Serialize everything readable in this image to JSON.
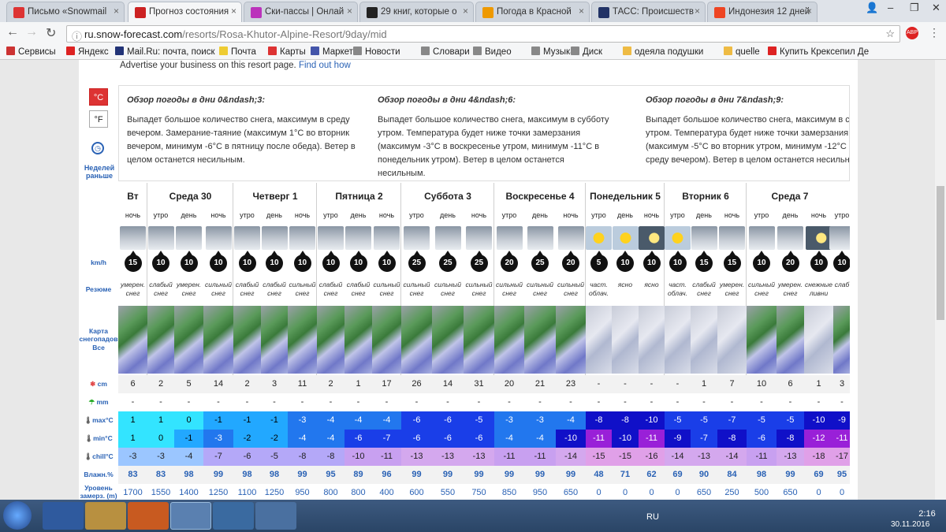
{
  "browser": {
    "tabs": [
      {
        "label": "Письмо «Snowmail",
        "color": "#d33"
      },
      {
        "label": "Прогноз состояния",
        "color": "#c22",
        "active": true
      },
      {
        "label": "Ски-пассы | Онлай",
        "color": "#b3b"
      },
      {
        "label": "29 книг, которые о",
        "color": "#222"
      },
      {
        "label": "Погода в Красной",
        "color": "#e90"
      },
      {
        "label": "ТАСС: Происшеств",
        "color": "#236"
      },
      {
        "label": "Индонезия 12 дней",
        "color": "#e42"
      }
    ],
    "url_host": "ru.snow-forecast.com",
    "url_path": "/resorts/Rosa-Khutor-Alpine-Resort/9day/mid",
    "bookmarks": [
      "Сервисы",
      "Яндекс",
      "Mail.Ru: почта, поиск",
      "Почта",
      "Карты",
      "Маркет",
      "Новости",
      "Словари",
      "Видео",
      "Музыка",
      "Диск",
      "одеяла подушки",
      "quelle",
      "Купить Крексепил Де"
    ]
  },
  "page": {
    "advertise": "Advertise your business on this resort page.",
    "advertise_link": "Find out how",
    "unit_c": "°C",
    "unit_f": "°F",
    "prev_weeks": "Неделей раньше",
    "summaries": [
      {
        "title": "Обзор погоды в дни 0&ndash;3:",
        "text": "Выпадет большое количество снега, максимум в среду вечером. Замерание-таяние (максимум 1°C во вторник вечером, минимум -6°C в пятницу после обеда). Ветер в целом останется несильным."
      },
      {
        "title": "Обзор погоды в дни 4&ndash;6:",
        "text": "Выпадет большое количество снега, максимум в субботу утром. Температура будет ниже точки замерзания (максимум -3°C в воскресенье утром, минимум -11°C в понедельник утром). Ветер в целом останется несильным."
      },
      {
        "title": "Обзор погоды в дни 7&ndash;9:",
        "text": "Выпадет большое количество снега, максимум в с утром. Температура будет ниже точки замерзания (максимум -5°C во вторник утром, минимум -12°C среду вечером). Ветер в целом останется несильн"
      }
    ],
    "labels": {
      "kmh": "km/h",
      "summary": "Резюме",
      "map": "Карта снегопадов",
      "map_all": "Все",
      "snow": "cm",
      "rain": "mm",
      "max": "max°C",
      "min": "min°C",
      "chill": "chill°C",
      "hum": "Влажн.%",
      "freeze": "Уровень замерз. (m)"
    },
    "days": [
      "Вт",
      "Среда 30",
      "Четверг 1",
      "Пятница 2",
      "Суббота 3",
      "Воскресенье 4",
      "Понедельник 5",
      "Вторник 6",
      "Среда 7"
    ],
    "periods": [
      "ночь",
      "утро",
      "день",
      "ночь",
      "утро",
      "день",
      "ночь",
      "утро",
      "день",
      "ночь",
      "утро",
      "день",
      "ночь",
      "утро",
      "день",
      "ночь",
      "утро",
      "день",
      "ночь",
      "утро",
      "день",
      "ночь",
      "утро",
      "день",
      "ночь",
      "утро"
    ],
    "wind": [
      "15",
      "10",
      "10",
      "10",
      "10",
      "10",
      "10",
      "10",
      "10",
      "10",
      "25",
      "25",
      "25",
      "20",
      "25",
      "20",
      "5",
      "10",
      "10",
      "10",
      "15",
      "15",
      "10",
      "20",
      "10",
      "10"
    ],
    "summ": [
      "умерен. снег",
      "слабый снег",
      "умерен. снег",
      "сильный снег",
      "слабый снег",
      "слабый снег",
      "сильный снег",
      "слабый снег",
      "слабый снег",
      "сильный снег",
      "сильный снег",
      "сильный снег",
      "сильный снег",
      "сильный снег",
      "сильный снег",
      "сильный снег",
      "част. облач.",
      "ясно",
      "ясно",
      "част. облач.",
      "слабый снег",
      "умерен. снег",
      "сильный снег",
      "умерен. снег",
      "снежные ливни",
      "слаб"
    ],
    "snow": [
      "6",
      "2",
      "5",
      "14",
      "2",
      "3",
      "11",
      "2",
      "1",
      "17",
      "26",
      "14",
      "31",
      "20",
      "21",
      "23",
      "-",
      "-",
      "-",
      "-",
      "1",
      "7",
      "10",
      "6",
      "1",
      "3"
    ],
    "rain": [
      "-",
      "-",
      "-",
      "-",
      "-",
      "-",
      "-",
      "-",
      "-",
      "-",
      "-",
      "-",
      "-",
      "-",
      "-",
      "-",
      "-",
      "-",
      "-",
      "-",
      "-",
      "-",
      "-",
      "-",
      "-",
      "-"
    ],
    "max": [
      "1",
      "1",
      "0",
      "-1",
      "-1",
      "-1",
      "-3",
      "-4",
      "-4",
      "-4",
      "-6",
      "-6",
      "-5",
      "-3",
      "-3",
      "-4",
      "-8",
      "-8",
      "-10",
      "-5",
      "-5",
      "-7",
      "-5",
      "-5",
      "-10",
      "-9"
    ],
    "min": [
      "1",
      "0",
      "-1",
      "-3",
      "-2",
      "-2",
      "-4",
      "-4",
      "-6",
      "-7",
      "-6",
      "-6",
      "-6",
      "-4",
      "-4",
      "-10",
      "-11",
      "-10",
      "-11",
      "-9",
      "-7",
      "-8",
      "-6",
      "-8",
      "-12",
      "-11"
    ],
    "chill": [
      "-3",
      "-3",
      "-4",
      "-7",
      "-6",
      "-5",
      "-8",
      "-8",
      "-10",
      "-11",
      "-13",
      "-13",
      "-13",
      "-11",
      "-11",
      "-14",
      "-15",
      "-15",
      "-16",
      "-14",
      "-13",
      "-14",
      "-11",
      "-13",
      "-18",
      "-17"
    ],
    "hum": [
      "83",
      "83",
      "98",
      "99",
      "98",
      "98",
      "99",
      "95",
      "89",
      "96",
      "99",
      "99",
      "99",
      "99",
      "99",
      "99",
      "48",
      "71",
      "62",
      "69",
      "90",
      "84",
      "98",
      "99",
      "69",
      "95"
    ],
    "freeze": [
      "1700",
      "1550",
      "1400",
      "1250",
      "1100",
      "1250",
      "950",
      "800",
      "800",
      "400",
      "600",
      "550",
      "750",
      "850",
      "950",
      "650",
      "0",
      "0",
      "0",
      "0",
      "650",
      "250",
      "500",
      "650",
      "0",
      "0"
    ]
  },
  "taskbar": {
    "lang": "RU",
    "time": "2:16",
    "date": "30.11.2016"
  }
}
